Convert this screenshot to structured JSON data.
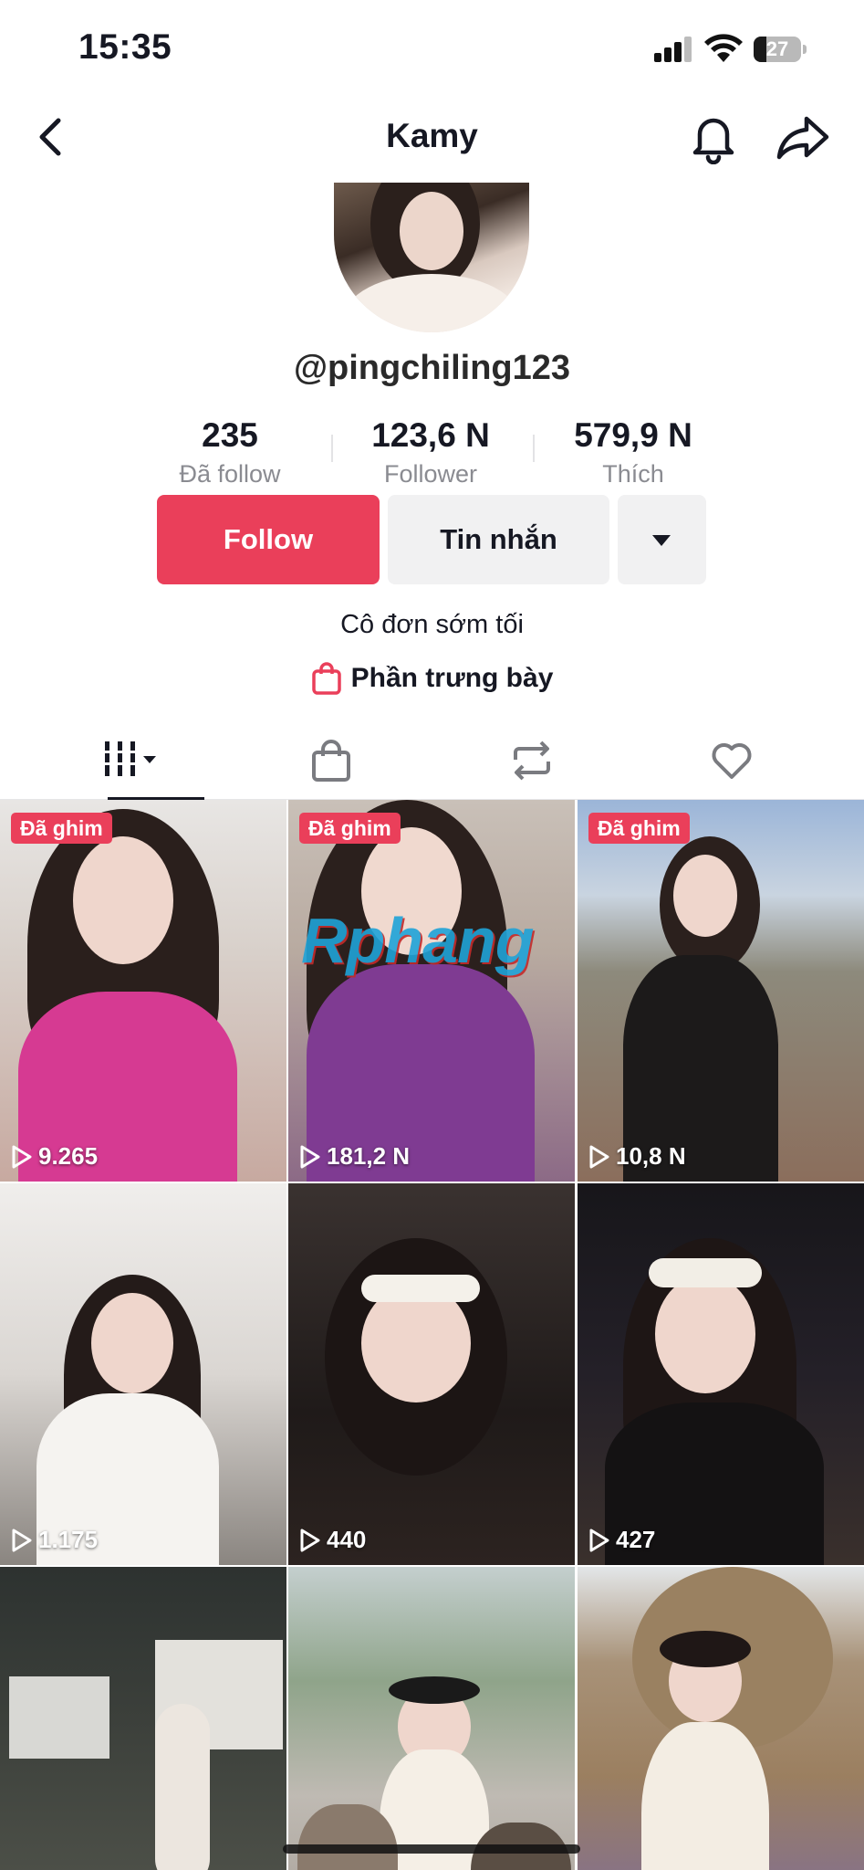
{
  "status_bar": {
    "time": "15:35",
    "battery_level": "27",
    "icons": [
      "signal-icon",
      "wifi-icon",
      "battery-icon"
    ]
  },
  "nav": {
    "title": "Kamy",
    "icons": [
      "back-icon",
      "bell-icon",
      "share-icon"
    ]
  },
  "profile": {
    "username": "@pingchiling123",
    "bio": "Cô đơn sớm tối",
    "showcase_label": "Phần trưng bày"
  },
  "stats": [
    {
      "value": "235",
      "label": "Đã follow"
    },
    {
      "value": "123,6 N",
      "label": "Follower"
    },
    {
      "value": "579,9 N",
      "label": "Thích"
    }
  ],
  "actions": {
    "follow_label": "Follow",
    "message_label": "Tin nhắn"
  },
  "tabs": [
    "videos-grid-icon",
    "shop-bag-icon",
    "repost-icon",
    "liked-heart-icon"
  ],
  "watermark": "Rphang",
  "videos": [
    {
      "pinned": "Đã ghim",
      "views": "9.265"
    },
    {
      "pinned": "Đã ghim",
      "views": "181,2 N"
    },
    {
      "pinned": "Đã ghim",
      "views": "10,8 N"
    },
    {
      "pinned": "",
      "views": "1.175"
    },
    {
      "pinned": "",
      "views": "440"
    },
    {
      "pinned": "",
      "views": "427"
    },
    {
      "pinned": "",
      "views": ""
    },
    {
      "pinned": "",
      "views": ""
    },
    {
      "pinned": "",
      "views": ""
    }
  ],
  "colors": {
    "accent": "#ea3f5a",
    "text": "#161823",
    "muted": "#8a8b91",
    "button_bg": "#f1f1f2"
  }
}
